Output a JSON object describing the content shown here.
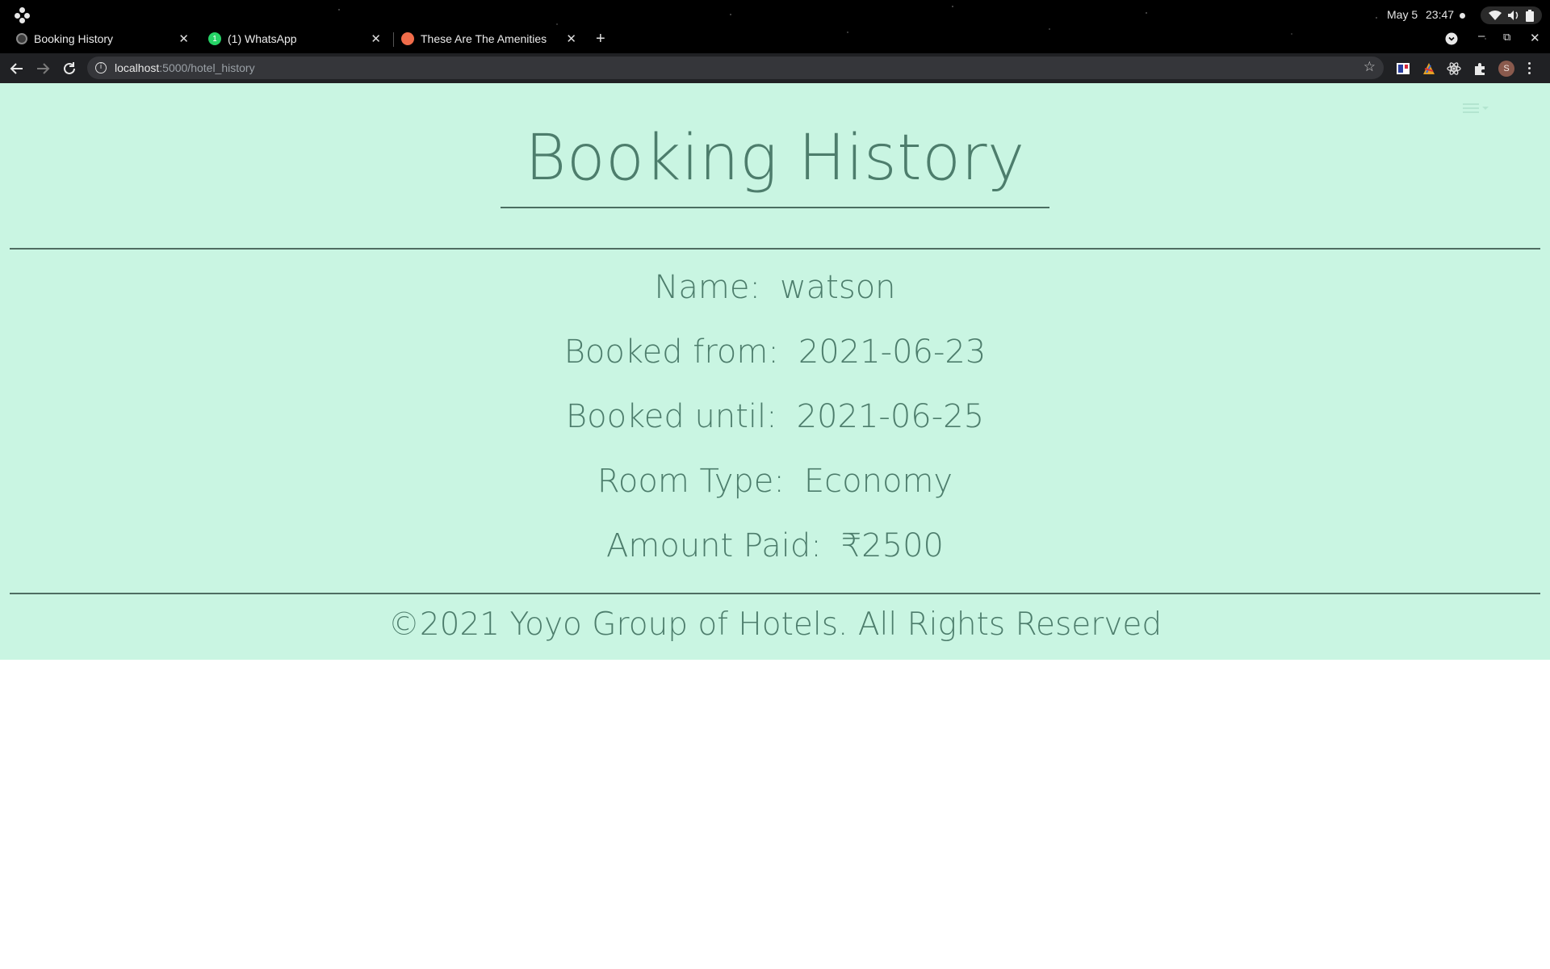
{
  "system_bar": {
    "date": "May 5",
    "time": "23:47"
  },
  "browser": {
    "tabs": [
      {
        "title": "Booking History",
        "favicon": "globe-icon",
        "active": true
      },
      {
        "title": "(1) WhatsApp",
        "favicon": "whatsapp-icon",
        "badge": "1"
      },
      {
        "title": "These Are The Amenities",
        "favicon": "orange-circle-icon"
      }
    ],
    "new_tab_label": "+",
    "url_host": "localhost",
    "url_path": ":5000/hotel_history",
    "avatar_letter": "S"
  },
  "page": {
    "title": "Booking History",
    "details": [
      {
        "label": "Name:",
        "value": "watson"
      },
      {
        "label": "Booked from:",
        "value": "2021-06-23"
      },
      {
        "label": "Booked until:",
        "value": "2021-06-25"
      },
      {
        "label": "Room Type:",
        "value": "Economy"
      },
      {
        "label": "Amount Paid:",
        "value": "₹2500"
      }
    ],
    "footer": "©2021 Yoyo Group of Hotels. All Rights Reserved"
  },
  "colors": {
    "page_background": "#c9f5e2",
    "text": "#4d7d6c",
    "rule": "#4f6d62",
    "browser_chrome": "#202124"
  }
}
